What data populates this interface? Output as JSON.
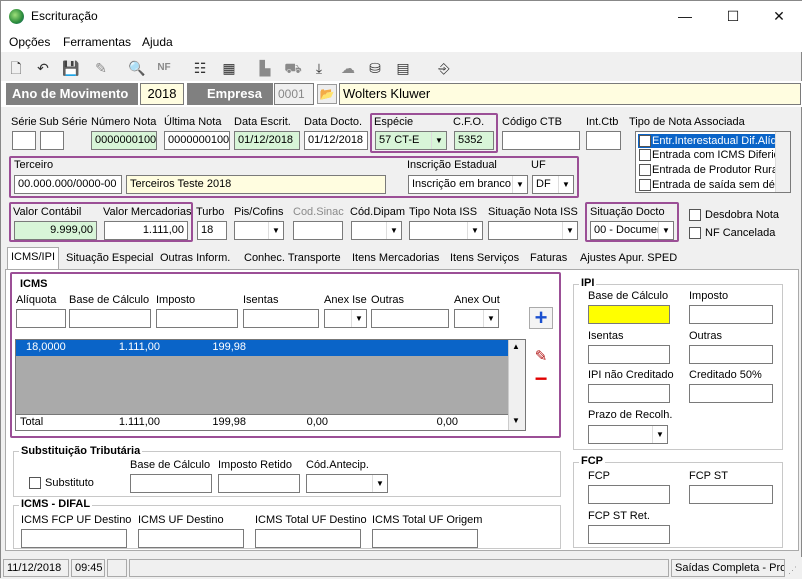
{
  "window": {
    "title": "Escrituração",
    "min": "—",
    "max": "☐",
    "close": "✕"
  },
  "menu": [
    {
      "label": "Opções"
    },
    {
      "label": "Ferramentas"
    },
    {
      "label": "Ajuda"
    }
  ],
  "top": {
    "ano_label": "Ano de Movimento",
    "ano_value": "2018",
    "empresa_label": "Empresa",
    "empresa_code": "0001",
    "empresa_name": "Wolters Kluwer"
  },
  "row1": {
    "serie_label": "Série",
    "sub_serie_label": "Sub Série",
    "numero_nota_label": "Número Nota",
    "numero_nota": "0000000100",
    "ultima_nota_label": "Última Nota",
    "ultima_nota": "0000000100",
    "data_escrit_label": "Data Escrit.",
    "data_escrit": "01/12/2018",
    "data_docto_label": "Data Docto.",
    "data_docto": "01/12/2018",
    "especie_label": "Espécie",
    "especie_value": "57   CT-E",
    "cfo_label": "C.F.O.",
    "cfo_value": "5352",
    "codigo_ctb_label": "Código CTB",
    "int_ctb_label": "Int.Ctb",
    "tipo_nota_label": "Tipo de Nota Associada"
  },
  "tipo_nota_items": [
    "Entr.Interestadual Dif.Alíq.",
    "Entrada com ICMS Diferido",
    "Entrada de Produtor Rural",
    "Entrada de saída sem débi"
  ],
  "row2": {
    "terceiro_label": "Terceiro",
    "terceiro_cnpj": "00.000.000/0000-00",
    "terceiro_nome": "Terceiros Teste 2018",
    "ie_label": "Inscrição Estadual",
    "ie_value": "Inscrição em branco",
    "uf_label": "UF",
    "uf_value": "DF"
  },
  "row3": {
    "valor_contabil_label": "Valor Contábil",
    "valor_contabil": "9.999,00",
    "valor_merc_label": "Valor Mercadorias",
    "valor_merc": "1.111,00",
    "turbo_label": "Turbo",
    "turbo_value": "18",
    "pis_label": "Pis/Cofins",
    "cod_sinac_label": "Cod.Sinac",
    "cod_dipam_label": "Cód.Dipam",
    "tipo_iss_label": "Tipo Nota ISS",
    "sit_iss_label": "Situação Nota ISS",
    "sit_docto_label": "Situação Docto",
    "sit_docto_value": "00 - Documen",
    "desdobra_label": "Desdobra Nota",
    "nf_cancelada_label": "NF Cancelada"
  },
  "tabs": [
    "ICMS/IPI",
    "Situação Especial",
    "Outras Inform.",
    "Conhec. Transporte",
    "Itens Mercadorias",
    "Itens Serviços",
    "Faturas",
    "Ajustes Apur. SPED"
  ],
  "icms": {
    "title": "ICMS",
    "aliquota": "Alíquota",
    "base": "Base de Cálculo",
    "imposto": "Imposto",
    "isentas": "Isentas",
    "anex_ise": "Anex Ise",
    "outras": "Outras",
    "anex_out": "Anex Out",
    "row": {
      "aliquota": "18,0000",
      "base": "1.111,00",
      "imposto": "199,98"
    },
    "total": {
      "label": "Total",
      "base": "1.111,00",
      "imposto": "199,98",
      "isentas": "0,00",
      "outras": "0,00"
    }
  },
  "subst": {
    "title": "Substituição Tributária",
    "substituto": "Substituto",
    "base": "Base de Cálculo",
    "imposto": "Imposto Retido",
    "cod": "Cód.Antecip."
  },
  "difal": {
    "title": "ICMS - DIFAL",
    "fcp": "ICMS FCP UF Destino",
    "dest": "ICMS UF Destino",
    "total_dest": "ICMS Total UF Destino",
    "total_orig": "ICMS Total UF Origem"
  },
  "ipi": {
    "title": "IPI",
    "base": "Base de Cálculo",
    "imposto": "Imposto",
    "isentas": "Isentas",
    "outras": "Outras",
    "nao_cred": "IPI não Creditado",
    "cred50": "Creditado 50%",
    "prazo": "Prazo de Recolh."
  },
  "fcp": {
    "title": "FCP",
    "fcp": "FCP",
    "fcp_st": "FCP ST",
    "fcp_st_ret": "FCP ST Ret."
  },
  "status": {
    "date": "11/12/2018",
    "time": "09:45",
    "mode": "Saídas Completa - Pros"
  }
}
